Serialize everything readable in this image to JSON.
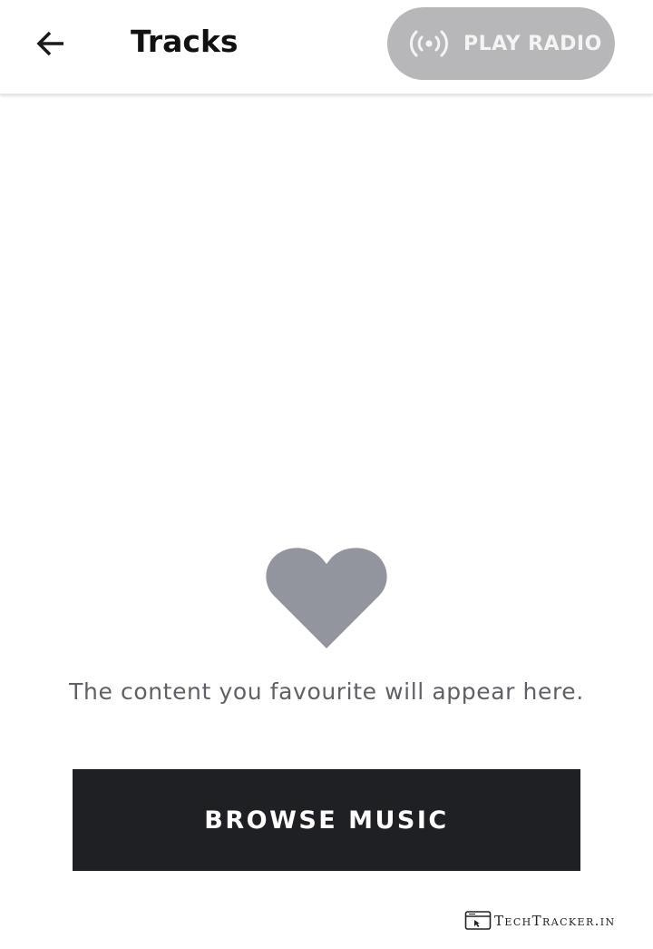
{
  "header": {
    "title": "Tracks",
    "back_icon": "arrow-left-icon",
    "play_radio": {
      "label": "PLAY RADIO",
      "icon": "radio-broadcast-icon",
      "bg_color": "#b7b7b9"
    }
  },
  "empty_state": {
    "icon": "heart-icon",
    "icon_color": "#92949e",
    "message": "The content you favourite will appear here."
  },
  "actions": {
    "browse_label": "BROWSE MUSIC",
    "browse_bg": "#1f2024"
  },
  "watermark": {
    "text": "TechTracker.in"
  }
}
